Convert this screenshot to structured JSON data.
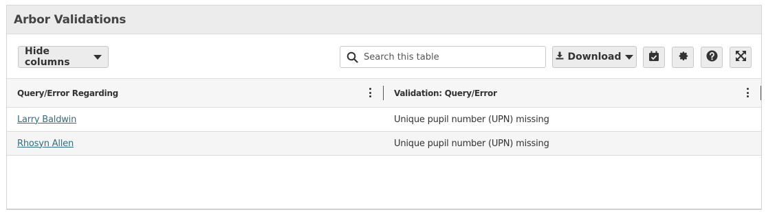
{
  "panel": {
    "title": "Arbor Validations"
  },
  "toolbar": {
    "hide_columns_label": "Hide columns",
    "search_placeholder": "Search this table",
    "search_value": "",
    "download_label": "Download",
    "icons": [
      "calendar-check-icon",
      "gear-icon",
      "help-icon",
      "expand-icon"
    ]
  },
  "table": {
    "columns": [
      "Query/Error Regarding",
      "Validation: Query/Error"
    ],
    "rows": [
      {
        "regarding": "Larry Baldwin",
        "error": "Unique pupil number (UPN) missing"
      },
      {
        "regarding": "Rhosyn Allen",
        "error": "Unique pupil number (UPN) missing"
      }
    ]
  },
  "colors": {
    "link": "#2f6e86",
    "header_bg": "#ececec",
    "button_bg": "#ececec"
  }
}
